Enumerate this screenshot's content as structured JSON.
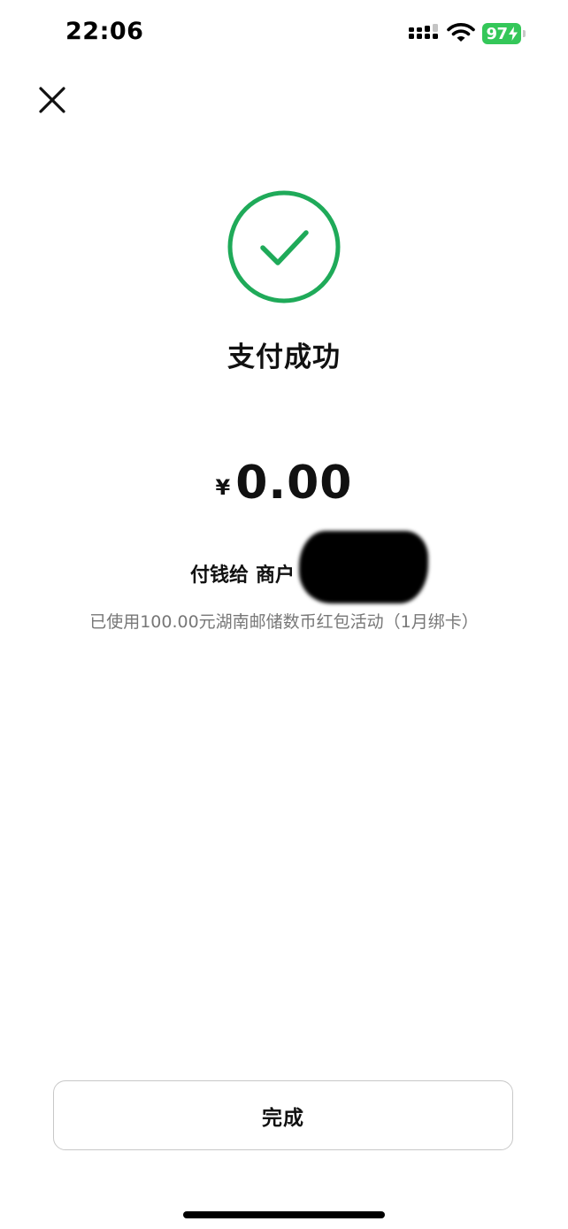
{
  "status_bar": {
    "time": "22:06",
    "battery_level": "97",
    "battery_charging": true,
    "battery_color": "#34c759",
    "signal_icon": "cellular-signal-icon",
    "wifi_icon": "wifi-icon"
  },
  "header": {
    "close_icon": "close-icon"
  },
  "result": {
    "icon": "check-circle-icon",
    "accent_color": "#1faa59",
    "title": "支付成功",
    "currency_symbol": "¥",
    "amount": "0.00",
    "payee_label": "付钱给",
    "payee_name": "商户",
    "promo_note": "已使用100.00元湖南邮储数币红包活动（1月绑卡）"
  },
  "footer": {
    "done_label": "完成"
  }
}
